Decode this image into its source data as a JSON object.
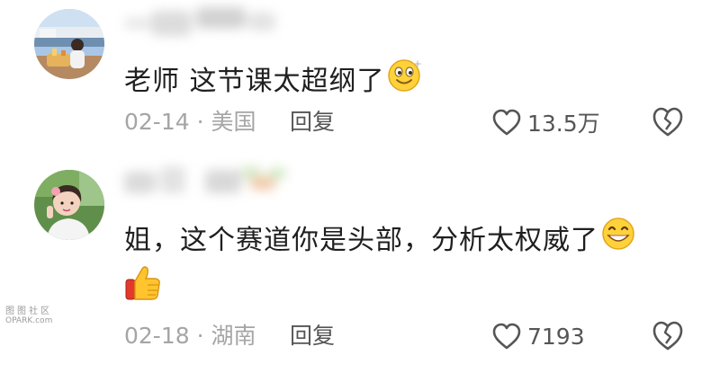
{
  "comments": [
    {
      "text": "老师 这节课太超纲了",
      "emoji": "smiling-face-emoji",
      "date": "02-14",
      "location": "美国",
      "reply_label": "回复",
      "like_count": "13.5万"
    },
    {
      "text": "姐，这个赛道你是头部，分析太权威了",
      "emoji": "grinning-face-emoji",
      "extra_emoji": "thumbs-up-emoji",
      "date": "02-18",
      "location": "湖南",
      "reply_label": "回复",
      "like_count": "7193"
    }
  ],
  "meta_separator": "·",
  "icons": {
    "like": "heart-outline-icon",
    "dislike": "broken-heart-icon"
  },
  "colors": {
    "meta_gray": "#a5a5a5",
    "action_gray": "#555555",
    "text": "#1f1f1f"
  },
  "watermark": {
    "line1": "图图社区",
    "line2": "OPARK.com"
  }
}
